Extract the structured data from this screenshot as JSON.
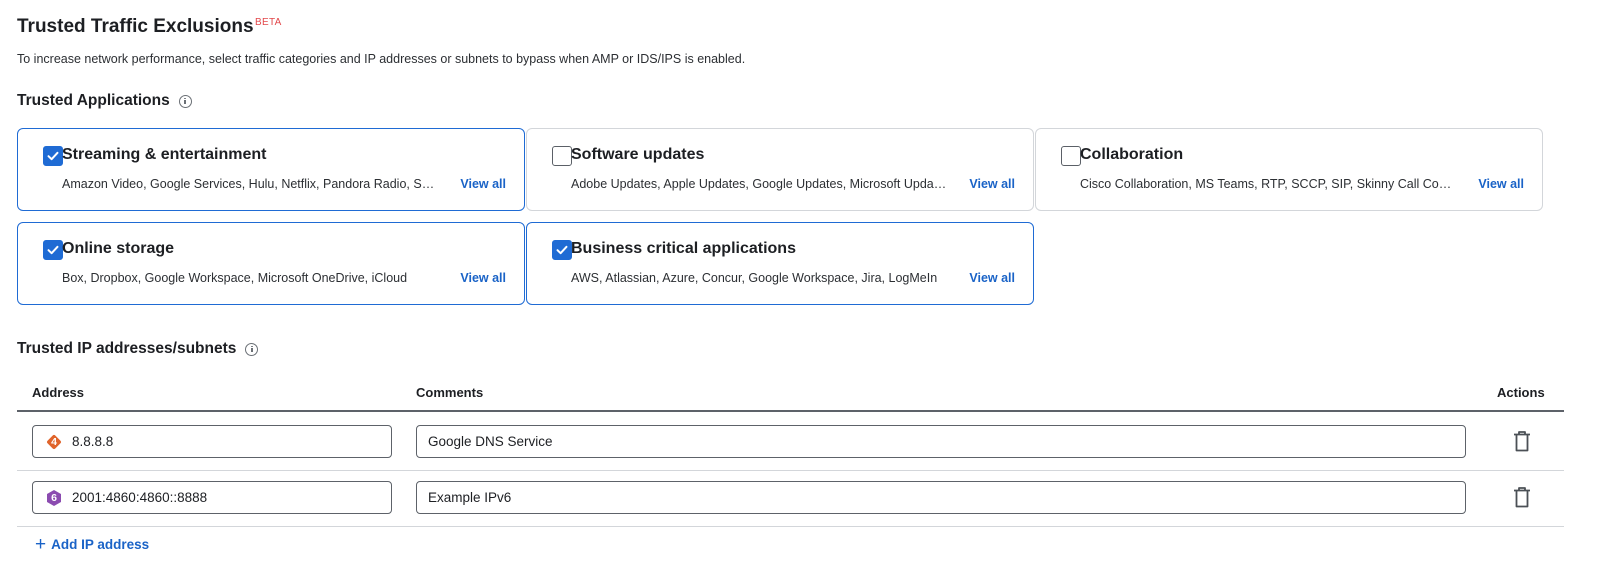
{
  "header": {
    "title": "Trusted Traffic Exclusions",
    "beta": "BETA",
    "description": "To increase network performance, select traffic categories and IP addresses or subnets to bypass when AMP or IDS/IPS is enabled."
  },
  "trusted_apps": {
    "heading": "Trusted Applications",
    "view_all_label": "View all",
    "cards": [
      {
        "title": "Streaming & entertainment",
        "checked": true,
        "apps": "Amazon Video, Google Services, Hulu, Netflix, Pandora Radio, Spotify"
      },
      {
        "title": "Software updates",
        "checked": false,
        "apps": "Adobe Updates, Apple Updates, Google Updates, Microsoft Updates"
      },
      {
        "title": "Collaboration",
        "checked": false,
        "apps": "Cisco Collaboration, MS Teams, RTP, SCCP, SIP, Skinny Call Control"
      },
      {
        "title": "Online storage",
        "checked": true,
        "apps": "Box, Dropbox, Google Workspace, Microsoft OneDrive, iCloud"
      },
      {
        "title": "Business critical applications",
        "checked": true,
        "apps": "AWS, Atlassian, Azure, Concur, Google Workspace, Jira, LogMeIn"
      }
    ]
  },
  "trusted_ips": {
    "heading": "Trusted IP addresses/subnets",
    "columns": {
      "address": "Address",
      "comments": "Comments",
      "actions": "Actions"
    },
    "rows": [
      {
        "version": "4",
        "address": "8.8.8.8",
        "comment": "Google DNS Service",
        "badge_color": "#e0642b"
      },
      {
        "version": "6",
        "address": "2001:4860:4860::8888",
        "comment": "Example IPv6",
        "badge_color": "#8b4bb0"
      }
    ],
    "add_label": "Add IP address"
  },
  "colors": {
    "accent": "#1f6bd4",
    "link": "#1a63c7",
    "beta": "#e2474a"
  }
}
